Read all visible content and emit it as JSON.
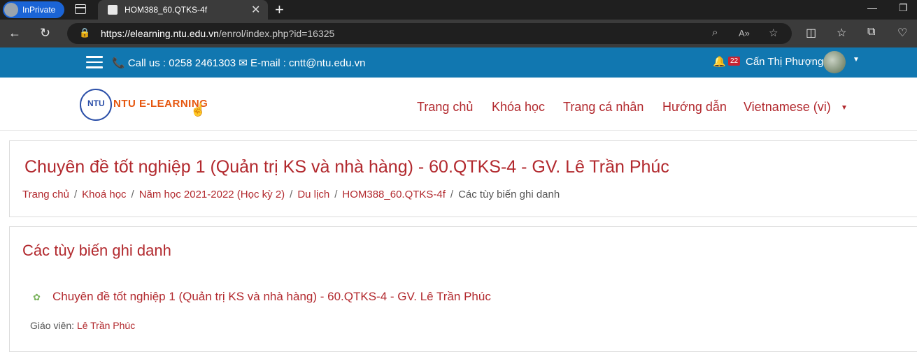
{
  "browser": {
    "inprivate_label": "InPrivate",
    "tab_title": "HOM388_60.QTKS-4f",
    "url_host": "https://elearning.ntu.edu.vn",
    "url_path": "/enrol/index.php?id=16325"
  },
  "topbar": {
    "contact": "📞 Call us : 0258 2461303 ✉ E-mail : cntt@ntu.edu.vn",
    "notification_count": "22",
    "user_name": "Cấn Thị Phượng"
  },
  "logo": {
    "text": "NTU E-LEARNING",
    "badge": "NTU"
  },
  "nav": {
    "items": [
      "Trang chủ",
      "Khóa học",
      "Trang cá nhân",
      "Hướng dẫn",
      "Vietnamese (vi)"
    ]
  },
  "page_header": {
    "course_title": "Chuyên đề tốt nghiệp 1 (Quản trị KS và nhà hàng) - 60.QTKS-4 - GV. Lê Trần Phúc",
    "breadcrumb": [
      "Trang chủ",
      "Khoá học",
      "Năm học 2021-2022 (Học kỳ 2)",
      "Du lịch",
      "HOM388_60.QTKS-4f",
      "Các tùy biến ghi danh"
    ]
  },
  "main": {
    "title": "Các tùy biến ghi danh",
    "course_link": "Chuyên đề tốt nghiệp 1 (Quản trị KS và nhà hàng) - 60.QTKS-4 - GV. Lê Trần Phúc",
    "teacher_label": "Giáo viên:",
    "teacher_name": "Lê Trần Phúc"
  }
}
